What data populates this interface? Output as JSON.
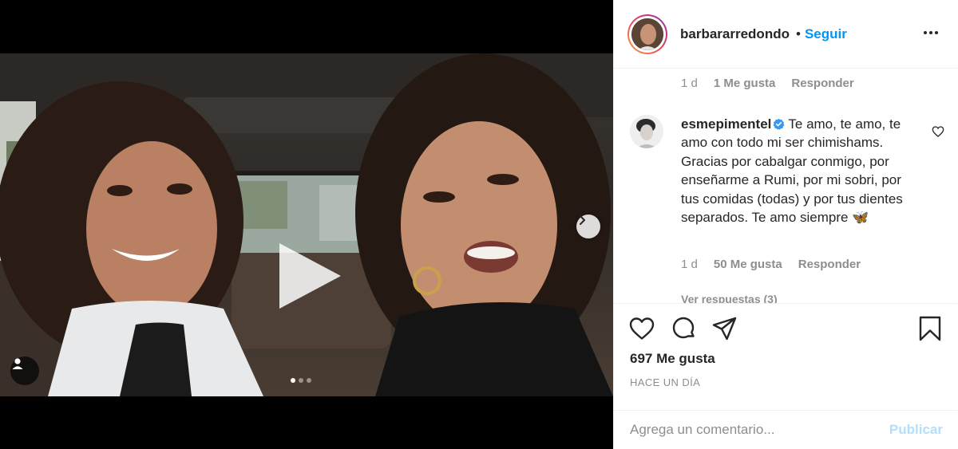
{
  "post": {
    "slide_count": 3,
    "active_slide": 1
  },
  "header": {
    "username": "barbararredondo",
    "separator": "•",
    "follow_label": "Seguir"
  },
  "comments": {
    "first_meta": {
      "age": "1 d",
      "likes": "1 Me gusta",
      "reply": "Responder"
    },
    "items": [
      {
        "username": "esmepimentel",
        "text": "Te amo, te amo, te amo con todo mi ser chimishams. Gracias por cabalgar conmigo, por enseñarme a Rumi, por mi sobri, por tus comidas (todas) y por tus dientes separados. Te amo siempre",
        "emoji": "🦋",
        "age": "1 d",
        "likes": "50 Me gusta",
        "reply": "Responder",
        "view_replies": "Ver respuestas (3)"
      }
    ]
  },
  "actions": {
    "likes_count": "697 Me gusta",
    "time_ago": "HACE UN DÍA"
  },
  "comment_box": {
    "placeholder": "Agrega un comentario...",
    "publish_label": "Publicar"
  },
  "colors": {
    "link_blue": "#0095f6",
    "publish_disabled": "#b2dffc",
    "muted_text": "#8e8e8e",
    "verified_blue": "#3897f0"
  },
  "icons": [
    "play-icon",
    "chevron-right-icon",
    "user-tag-icon",
    "more-icon",
    "verified-icon",
    "heart-icon",
    "comment-icon",
    "share-icon",
    "bookmark-icon"
  ]
}
